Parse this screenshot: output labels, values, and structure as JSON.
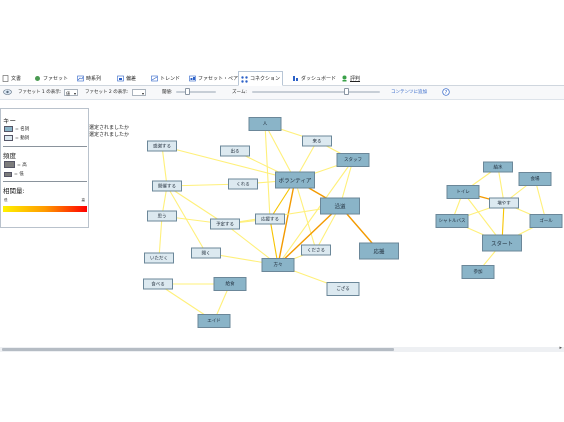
{
  "tabs": [
    {
      "label": "文書",
      "icon": "document-icon"
    },
    {
      "label": "ファセット",
      "icon": "facet-icon"
    },
    {
      "label": "時系列",
      "icon": "timeseries-icon"
    },
    {
      "label": "偏差",
      "icon": "deviation-icon"
    },
    {
      "label": "トレンド",
      "icon": "trend-icon"
    },
    {
      "label": "ファセット・ペア",
      "icon": "facet-pair-icon"
    },
    {
      "label": "コネクション",
      "icon": "connection-icon"
    },
    {
      "label": "ダッシュボード",
      "icon": "dashboard-icon"
    },
    {
      "label": "評判",
      "icon": "reputation-icon"
    }
  ],
  "active_tab": "コネクション",
  "toolbar": {
    "facet1_label": "ファセット 1 の表示:",
    "facet1_value": "値",
    "facet2_label": "ファセット 2 の表示:",
    "facet2_value": "",
    "threshold_label": "閾値:",
    "zoom_label": "ズーム:",
    "refresh_link": "コンテンツに追加",
    "help_icon": "help-icon"
  },
  "legend": {
    "key_title": "キー",
    "noun_label": "= 名詞",
    "verb_label": "= 動詞",
    "frequency_title": "頻度",
    "high_label": "= 高",
    "low_label": "= 低",
    "correlation_title": "相関量:",
    "low_end": "低",
    "high_end": "高",
    "noun_color": "#8ab4c8",
    "verb_color": "#dce9f0"
  },
  "messages": [
    "選定されましたか",
    "選定されましたか"
  ],
  "graph": {
    "nodes": [
      {
        "id": "hito",
        "label": "人",
        "type": "noun",
        "size": "m"
      },
      {
        "id": "kuru",
        "label": "来る",
        "type": "verb",
        "size": "s"
      },
      {
        "id": "dasu",
        "label": "出る",
        "type": "verb",
        "size": "s"
      },
      {
        "id": "kanshasuru",
        "label": "感謝する",
        "type": "verb",
        "size": "s"
      },
      {
        "id": "staff",
        "label": "スタッフ",
        "type": "noun",
        "size": "m"
      },
      {
        "id": "kaisaisuru",
        "label": "開催する",
        "type": "verb",
        "size": "s"
      },
      {
        "id": "kureru",
        "label": "くれる",
        "type": "verb",
        "size": "s"
      },
      {
        "id": "volunteer",
        "label": "ボランティア",
        "type": "noun",
        "size": "l"
      },
      {
        "id": "endo",
        "label": "沿道",
        "type": "noun",
        "size": "l"
      },
      {
        "id": "omou",
        "label": "思う",
        "type": "verb",
        "size": "s"
      },
      {
        "id": "ouensuru",
        "label": "応援する",
        "type": "verb",
        "size": "s"
      },
      {
        "id": "yoteisuru",
        "label": "予定する",
        "type": "verb",
        "size": "s"
      },
      {
        "id": "kudasaru",
        "label": "くださる",
        "type": "verb",
        "size": "s"
      },
      {
        "id": "ouen",
        "label": "応援",
        "type": "noun",
        "size": "l"
      },
      {
        "id": "itadaku",
        "label": "いただく",
        "type": "verb",
        "size": "s"
      },
      {
        "id": "hiraku",
        "label": "開く",
        "type": "verb",
        "size": "s"
      },
      {
        "id": "minasan",
        "label": "方々",
        "type": "noun",
        "size": "m"
      },
      {
        "id": "taberu",
        "label": "食べる",
        "type": "verb",
        "size": "s"
      },
      {
        "id": "kaijo",
        "label": "給食",
        "type": "noun",
        "size": "m"
      },
      {
        "id": "gozaru",
        "label": "ござる",
        "type": "verb",
        "size": "m"
      },
      {
        "id": "aid",
        "label": "エイド",
        "type": "noun",
        "size": "m"
      },
      {
        "id": "kyusui",
        "label": "給水",
        "type": "noun",
        "size": "s"
      },
      {
        "id": "kaijo2",
        "label": "会場",
        "type": "noun",
        "size": "m"
      },
      {
        "id": "toilet",
        "label": "トイレ",
        "type": "noun",
        "size": "m"
      },
      {
        "id": "fuyasu",
        "label": "増やす",
        "type": "verb",
        "size": "s"
      },
      {
        "id": "shuttlebus",
        "label": "シャトルバス",
        "type": "noun",
        "size": "m"
      },
      {
        "id": "goal",
        "label": "ゴール",
        "type": "noun",
        "size": "m"
      },
      {
        "id": "start",
        "label": "スタート",
        "type": "noun",
        "size": "l"
      },
      {
        "id": "sanka",
        "label": "参加",
        "type": "noun",
        "size": "m"
      }
    ],
    "edges": [
      [
        "hito",
        "kuru",
        0.2
      ],
      [
        "hito",
        "volunteer",
        0.3
      ],
      [
        "hito",
        "ouensuru",
        0.2
      ],
      [
        "kuru",
        "staff",
        0.2
      ],
      [
        "kuru",
        "volunteer",
        0.3
      ],
      [
        "dasu",
        "volunteer",
        0.2
      ],
      [
        "kanshasuru",
        "kaisaisuru",
        0.2
      ],
      [
        "kanshasuru",
        "volunteer",
        0.2
      ],
      [
        "staff",
        "volunteer",
        0.3
      ],
      [
        "staff",
        "endo",
        0.3
      ],
      [
        "staff",
        "minasan",
        0.3
      ],
      [
        "kaisaisuru",
        "kureru",
        0.2
      ],
      [
        "kaisaisuru",
        "omou",
        0.3
      ],
      [
        "kaisaisuru",
        "yoteisuru",
        0.3
      ],
      [
        "kaisaisuru",
        "hiraku",
        0.2
      ],
      [
        "kureru",
        "volunteer",
        0.4
      ],
      [
        "volunteer",
        "endo",
        0.6
      ],
      [
        "volunteer",
        "ouensuru",
        0.5
      ],
      [
        "volunteer",
        "minasan",
        0.8
      ],
      [
        "volunteer",
        "kudasaru",
        0.4
      ],
      [
        "endo",
        "ouen",
        0.7
      ],
      [
        "endo",
        "kudasaru",
        0.4
      ],
      [
        "endo",
        "minasan",
        0.6
      ],
      [
        "endo",
        "yoteisuru",
        0.3
      ],
      [
        "omou",
        "yoteisuru",
        0.3
      ],
      [
        "omou",
        "itadaku",
        0.2
      ],
      [
        "ouensuru",
        "minasan",
        0.5
      ],
      [
        "ouensuru",
        "yoteisuru",
        0.2
      ],
      [
        "yoteisuru",
        "minasan",
        0.3
      ],
      [
        "minasan",
        "gozaru",
        0.3
      ],
      [
        "minasan",
        "kudasaru",
        0.3
      ],
      [
        "minasan",
        "hiraku",
        0.2
      ],
      [
        "taberu",
        "kaijo",
        0.2
      ],
      [
        "taberu",
        "aid",
        0.2
      ],
      [
        "kaijo",
        "aid",
        0.2
      ],
      [
        "kyusui",
        "fuyasu",
        0.4
      ],
      [
        "kyusui",
        "toilet",
        0.3
      ],
      [
        "kaijo2",
        "fuyasu",
        0.3
      ],
      [
        "kaijo2",
        "goal",
        0.3
      ],
      [
        "toilet",
        "fuyasu",
        0.6
      ],
      [
        "toilet",
        "shuttlebus",
        0.3
      ],
      [
        "fuyasu",
        "shuttlebus",
        0.4
      ],
      [
        "fuyasu",
        "goal",
        0.4
      ],
      [
        "fuyasu",
        "start",
        0.5
      ],
      [
        "shuttlebus",
        "start",
        0.3
      ],
      [
        "start",
        "goal",
        0.3
      ],
      [
        "start",
        "sanka",
        0.3
      ],
      [
        "toilet",
        "start",
        0.3
      ]
    ]
  }
}
